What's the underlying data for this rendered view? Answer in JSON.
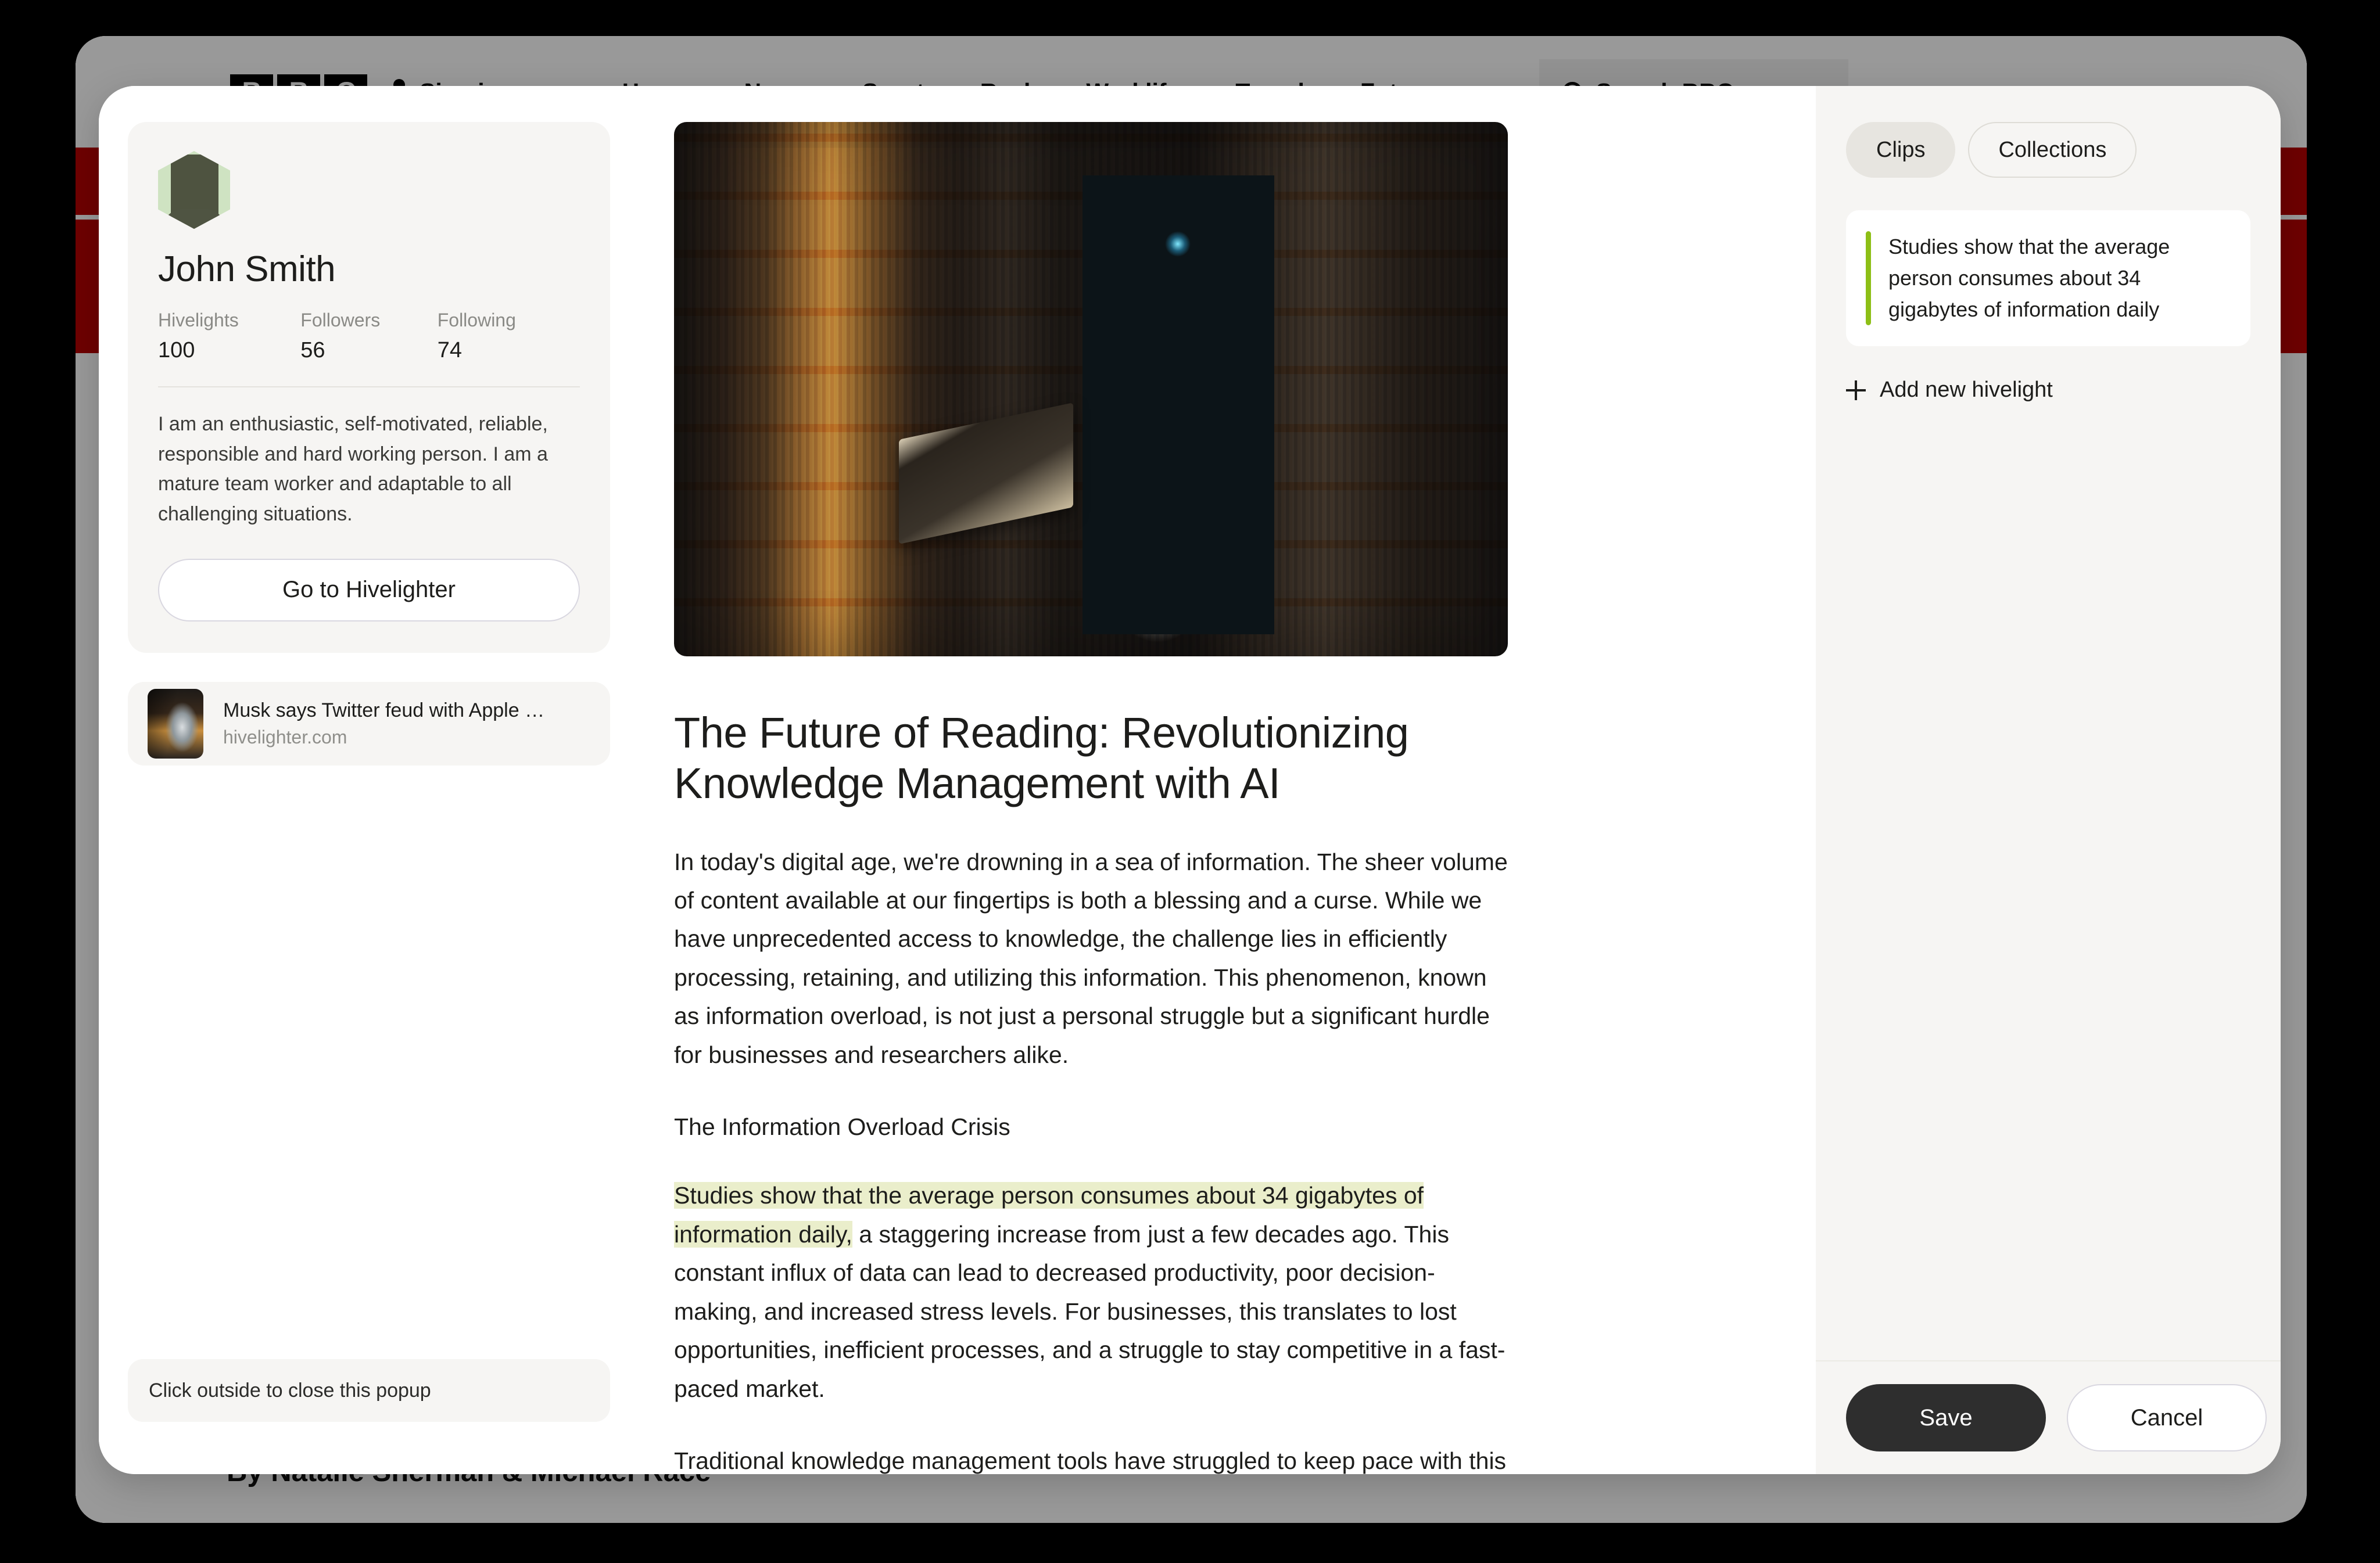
{
  "bbc": {
    "logo_letters": [
      "B",
      "B",
      "C"
    ],
    "sign_in": "Sign in",
    "nav": [
      "Home",
      "News",
      "Sport",
      "Reel",
      "Worklife",
      "Travel",
      "Future"
    ],
    "more_icon": "•••",
    "search_placeholder": "Search BBC",
    "byline": "By Natalie Sherman & Michael Race"
  },
  "profile": {
    "name": "John Smith",
    "stats": [
      {
        "label": "Hivelights",
        "value": "100"
      },
      {
        "label": "Followers",
        "value": "56"
      },
      {
        "label": "Following",
        "value": "74"
      }
    ],
    "bio": "I am an enthusiastic, self-motivated, reliable, responsible and hard working person. I am a mature team worker and adaptable to all challenging situations.",
    "cta_label": "Go to Hivelighter",
    "link_card": {
      "title": "Musk says Twitter feud with Apple bos…",
      "domain": "hivelighter.com"
    },
    "close_hint": "Click outside to close this popup"
  },
  "article": {
    "title": "The Future of Reading: Revolutionizing Knowledge Management with AI",
    "paragraphs": [
      "In today's digital age,  we're drowning in a sea of information. The sheer volume of content available at our fingertips is both a blessing and a curse. While we have unprecedented access to knowledge, the challenge lies in efficiently processing, retaining, and utilizing this information. This phenomenon, known as information overload, is not just a personal struggle but a significant hurdle for businesses and researchers alike.",
      "The Information Overload Crisis"
    ],
    "highlighted_text": "Studies show that the average person consumes about 34 gigabytes of information daily,",
    "highlighted_rest": " a staggering increase from just a few decades ago. This constant influx of data can lead to decreased productivity, poor decision-making, and increased stress levels. For businesses, this translates to lost opportunities, inefficient processes, and a struggle to stay competitive in a fast-paced market.",
    "last_paragraph": "Traditional knowledge management tools have struggled to keep pace with this"
  },
  "panel": {
    "tabs": [
      {
        "label": "Clips",
        "state": "active"
      },
      {
        "label": "Collections",
        "state": "idle"
      }
    ],
    "clip_text": "Studies show that the average person consumes about 34 gigabytes of information daily",
    "add_label": "Add new hivelight",
    "save_label": "Save",
    "cancel_label": "Cancel"
  },
  "colors": {
    "highlight": "#eaeecb",
    "clip_accent": "#8dbf16",
    "bbc_red": "#B80000",
    "save_bg": "#2e2e2e",
    "avatar_bg": "#cfe3c2"
  }
}
